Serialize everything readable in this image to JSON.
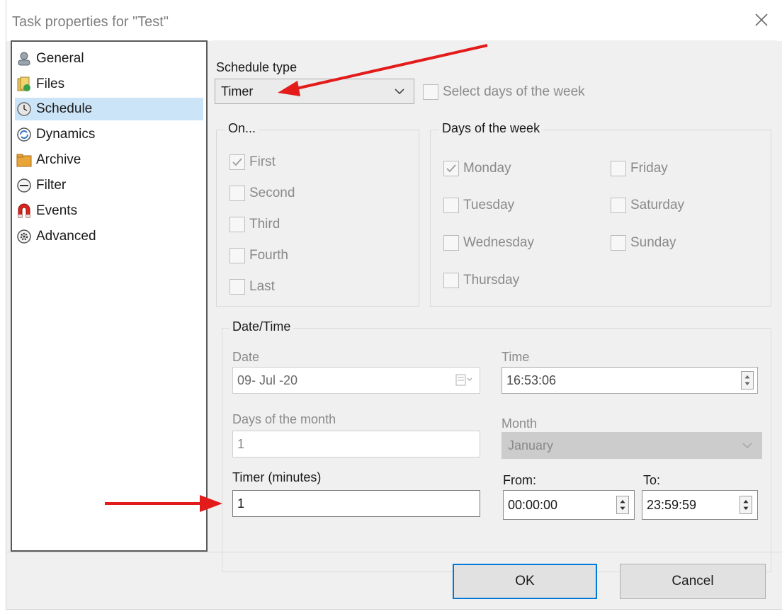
{
  "window": {
    "title": "Task properties for \"Test\""
  },
  "nav": {
    "items": [
      {
        "label": "General",
        "icon": "user-icon"
      },
      {
        "label": "Files",
        "icon": "files-icon"
      },
      {
        "label": "Schedule",
        "icon": "clock-icon",
        "selected": true
      },
      {
        "label": "Dynamics",
        "icon": "refresh-icon"
      },
      {
        "label": "Archive",
        "icon": "archive-folder-icon"
      },
      {
        "label": "Filter",
        "icon": "filter-icon"
      },
      {
        "label": "Events",
        "icon": "magnet-icon"
      },
      {
        "label": "Advanced",
        "icon": "gear-icon"
      }
    ]
  },
  "schedule": {
    "type_label": "Schedule type",
    "type_value": "Timer",
    "select_days_label": "Select days of the week"
  },
  "on_group": {
    "title": "On...",
    "items": [
      {
        "label": "First",
        "checked": true
      },
      {
        "label": "Second",
        "checked": false
      },
      {
        "label": "Third",
        "checked": false
      },
      {
        "label": "Fourth",
        "checked": false
      },
      {
        "label": "Last",
        "checked": false
      }
    ]
  },
  "days_group": {
    "title": "Days of the week",
    "items": [
      {
        "label": "Monday",
        "checked": true
      },
      {
        "label": "Tuesday",
        "checked": false
      },
      {
        "label": "Wednesday",
        "checked": false
      },
      {
        "label": "Thursday",
        "checked": false
      },
      {
        "label": "Friday",
        "checked": false
      },
      {
        "label": "Saturday",
        "checked": false
      },
      {
        "label": "Sunday",
        "checked": false
      }
    ]
  },
  "datetime": {
    "title": "Date/Time",
    "date_label": "Date",
    "date_value": "09- Jul -20",
    "time_label": "Time",
    "time_value": "16:53:06",
    "days_month_label": "Days of the month",
    "days_month_value": "1",
    "month_label": "Month",
    "month_value": "January",
    "timer_label": "Timer (minutes)",
    "timer_value": "1",
    "from_label": "From:",
    "from_value": "00:00:00",
    "to_label": "To:",
    "to_value": "23:59:59"
  },
  "buttons": {
    "ok": "OK",
    "cancel": "Cancel"
  },
  "colors": {
    "selection": "#cce4f7",
    "annotation_arrow": "#e31b1b",
    "default_button_border": "#0078d7"
  }
}
